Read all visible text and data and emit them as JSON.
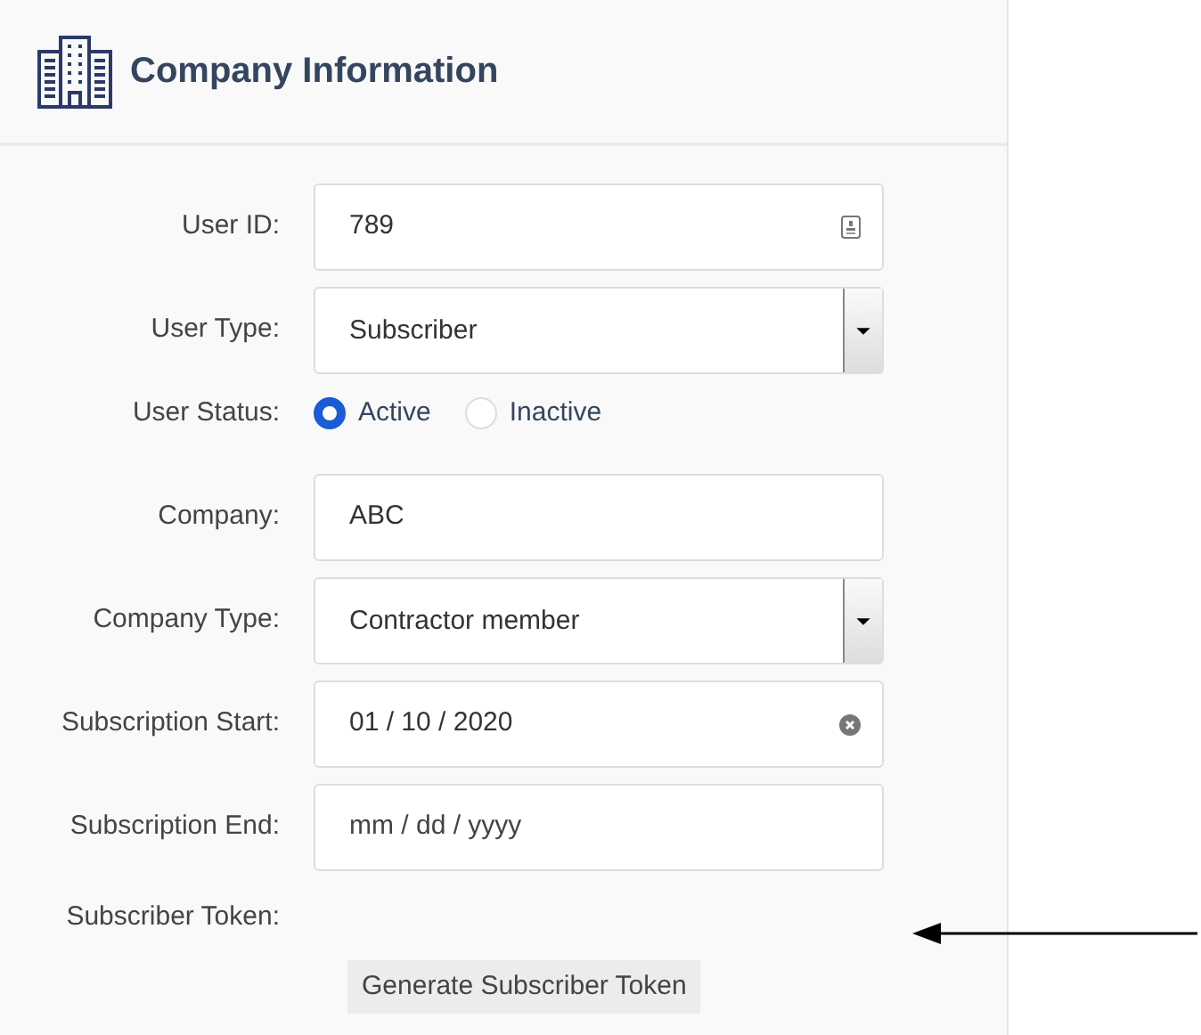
{
  "header": {
    "title": "Company Information"
  },
  "fields": [
    {
      "kind": "id",
      "label": "User ID:",
      "value": "789"
    },
    {
      "kind": "select",
      "label": "User Type:",
      "value": "Subscriber"
    },
    {
      "kind": "radio",
      "label": "User Status:",
      "options": [
        {
          "label": "Active",
          "selected": true
        },
        {
          "label": "Inactive",
          "selected": false
        }
      ]
    },
    {
      "kind": "text",
      "label": "Company:",
      "value": "ABC"
    },
    {
      "kind": "select",
      "label": "Company Type:",
      "value": "Contractor member"
    },
    {
      "kind": "date",
      "label": "Subscription Start:",
      "value": "01 / 10 / 2020"
    },
    {
      "kind": "date",
      "label": "Subscription End:",
      "placeholder": "mm / dd / yyyy"
    },
    {
      "kind": "token",
      "label": "Subscriber Token:"
    }
  ],
  "generate_button": "Generate Subscriber Token"
}
